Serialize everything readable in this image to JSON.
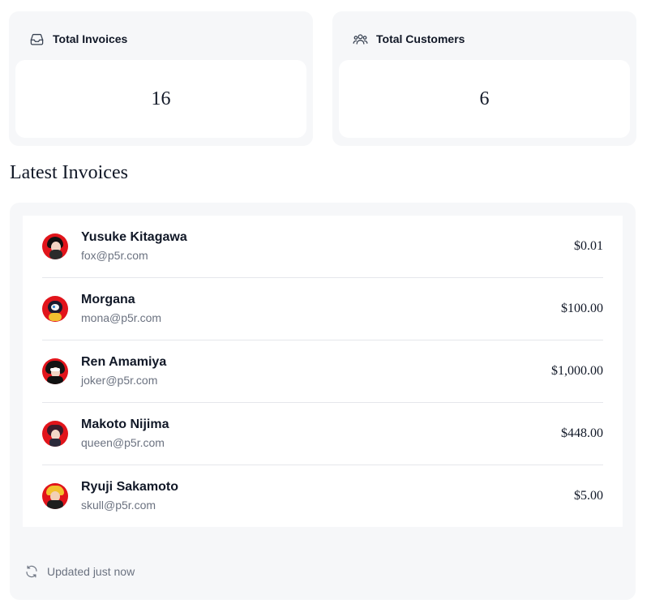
{
  "cards": {
    "invoices": {
      "icon": "inbox-icon",
      "title": "Total Invoices",
      "value": "16"
    },
    "customers": {
      "icon": "users-icon",
      "title": "Total Customers",
      "value": "6"
    }
  },
  "latest": {
    "title": "Latest Invoices",
    "rows": [
      {
        "name": "Yusuke Kitagawa",
        "email": "fox@p5r.com",
        "amount": "$0.01"
      },
      {
        "name": "Morgana",
        "email": "mona@p5r.com",
        "amount": "$100.00"
      },
      {
        "name": "Ren Amamiya",
        "email": "joker@p5r.com",
        "amount": "$1,000.00"
      },
      {
        "name": "Makoto Nijima",
        "email": "queen@p5r.com",
        "amount": "$448.00"
      },
      {
        "name": "Ryuji Sakamoto",
        "email": "skull@p5r.com",
        "amount": "$5.00"
      }
    ],
    "footer": {
      "icon": "refresh-icon",
      "text": "Updated just now"
    }
  },
  "colors": {
    "panel_bg": "#f6f7f9",
    "avatar_red": "#e1141b",
    "muted_text": "#6b7280"
  }
}
